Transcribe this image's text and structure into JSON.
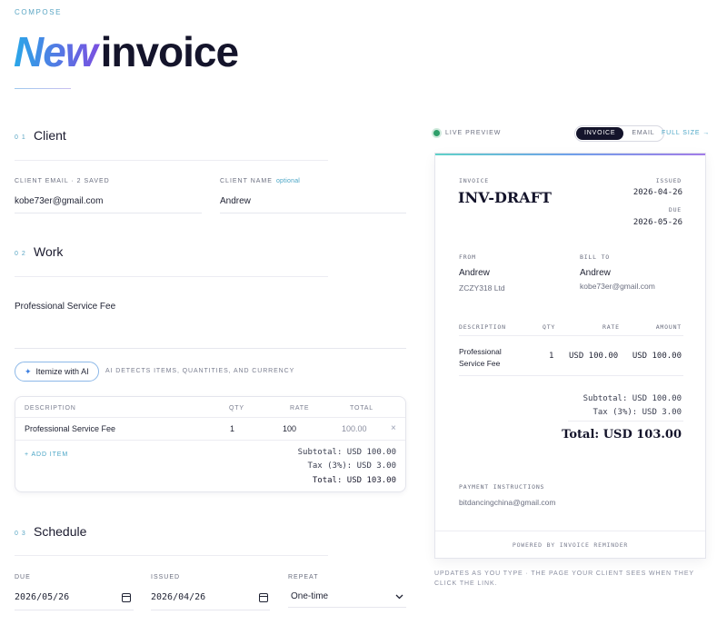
{
  "header": {
    "eyebrow": "COMPOSE",
    "title_accent": "New",
    "title_rest": "invoice"
  },
  "sections": {
    "client": {
      "num": "0 1",
      "title": "Client"
    },
    "work": {
      "num": "0 2",
      "title": "Work"
    },
    "schedule": {
      "num": "0 3",
      "title": "Schedule"
    }
  },
  "client": {
    "email_label": "CLIENT EMAIL · 2 SAVED",
    "email_value": "kobe73er@gmail.com",
    "name_label": "CLIENT NAME",
    "name_optional": "optional",
    "name_value": "Andrew"
  },
  "work": {
    "description": "Professional Service Fee",
    "ai_button": "Itemize with AI",
    "ai_note": "AI DETECTS ITEMS, QUANTITIES, AND CURRENCY"
  },
  "items_table": {
    "headers": {
      "description": "DESCRIPTION",
      "qty": "QTY",
      "rate": "RATE",
      "total": "TOTAL"
    },
    "rows": [
      {
        "description": "Professional Service Fee",
        "qty": "1",
        "rate": "100",
        "total": "100.00"
      }
    ],
    "remove_glyph": "×",
    "add_item": "+ ADD ITEM",
    "subtotal": "Subtotal: USD 100.00",
    "tax": "Tax (3%): USD 3.00",
    "total": "Total: USD 103.00"
  },
  "schedule": {
    "due_label": "DUE",
    "due_value": "2026/05/26",
    "issued_label": "ISSUED",
    "issued_value": "2026/04/26",
    "repeat_label": "REPEAT",
    "repeat_value": "One-time"
  },
  "preview": {
    "live_label": "LIVE PREVIEW",
    "tab_invoice": "INVOICE",
    "tab_email": "EMAIL",
    "full_size": "FULL SIZE →",
    "invoice_label": "INVOICE",
    "invoice_number": "INV-DRAFT",
    "issued_label": "ISSUED",
    "issued_date": "2026-04-26",
    "due_label": "DUE",
    "due_date": "2026-05-26",
    "from_label": "FROM",
    "from_name": "Andrew",
    "from_company": "ZCZY318 Ltd",
    "bill_to_label": "BILL TO",
    "bill_to_name": "Andrew",
    "bill_to_email": "kobe73er@gmail.com",
    "table_headers": {
      "description": "DESCRIPTION",
      "qty": "QTY",
      "rate": "RATE",
      "amount": "AMOUNT"
    },
    "row": {
      "description_line1": "Professional",
      "description_line2": "Service Fee",
      "qty": "1",
      "rate": "USD 100.00",
      "amount": "USD 100.00"
    },
    "subtotal": "Subtotal: USD 100.00",
    "tax": "Tax (3%): USD 3.00",
    "total": "Total: USD 103.00",
    "payment_label": "PAYMENT INSTRUCTIONS",
    "payment_value": "bitdancingchina@gmail.com",
    "footer": "POWERED BY INVOICE REMINDER",
    "caption": "UPDATES AS YOU TYPE · THE PAGE YOUR CLIENT SEES WHEN THEY CLICK THE LINK."
  },
  "colors": {
    "accent_teal": "#4aa5c6",
    "title_gradient_start": "#2aa7e8",
    "title_gradient_end": "#7b4ee0",
    "live_dot": "#2e9f6a",
    "dark": "#14142b"
  }
}
